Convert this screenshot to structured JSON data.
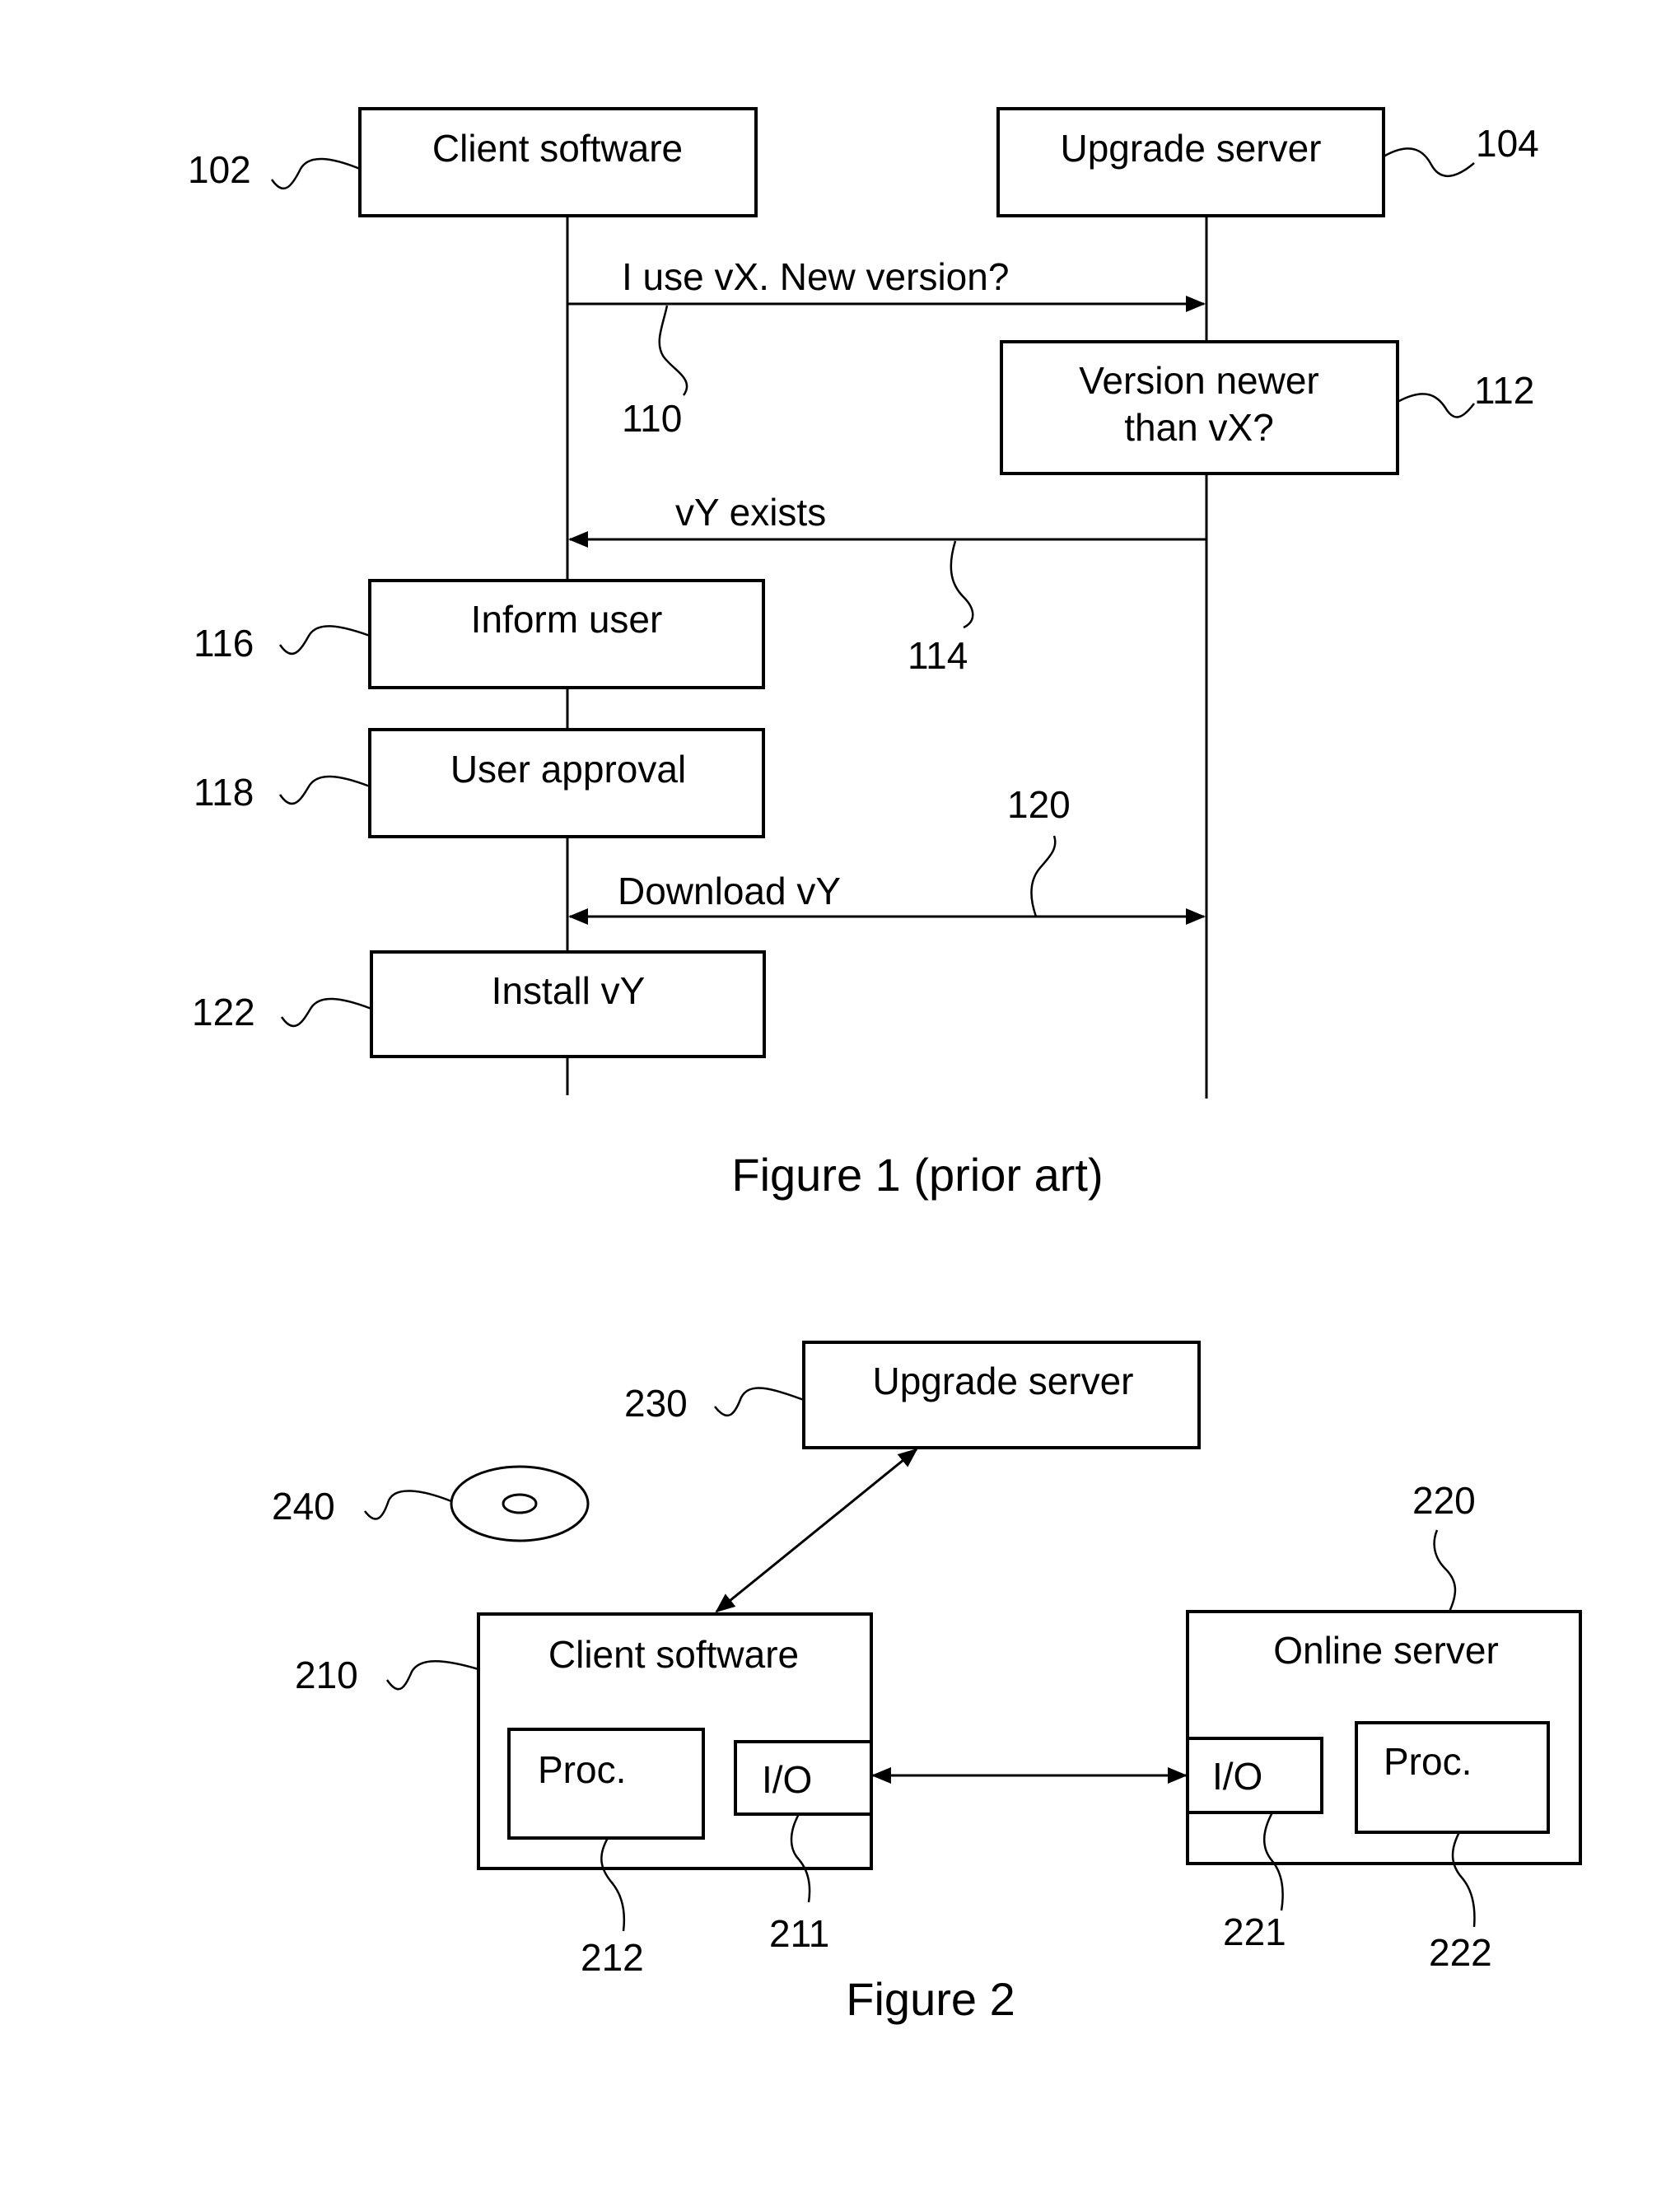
{
  "figure1": {
    "caption": "Figure 1 (prior art)",
    "lifelines": [
      {
        "ref": "102",
        "label": "Client software"
      },
      {
        "ref": "104",
        "label": "Upgrade server"
      }
    ],
    "steps": [
      {
        "ref": "112",
        "line1": "Version newer",
        "line2": "than vX?"
      },
      {
        "ref": "116",
        "label": "Inform user"
      },
      {
        "ref": "118",
        "label": "User approval"
      },
      {
        "ref": "122",
        "label": "Install vY"
      }
    ],
    "messages": [
      {
        "ref": "110",
        "label": "I use vX. New version?",
        "direction": "client-to-server"
      },
      {
        "ref": "114",
        "label": "vY exists",
        "direction": "server-to-client"
      },
      {
        "ref": "120",
        "label": "Download vY",
        "direction": "bidirectional"
      }
    ]
  },
  "figure2": {
    "caption": "Figure 2",
    "upgrade_server": {
      "ref": "230",
      "label": "Upgrade server"
    },
    "disc": {
      "ref": "240"
    },
    "client": {
      "ref": "210",
      "label": "Client software",
      "proc": {
        "ref": "212",
        "label": "Proc."
      },
      "io": {
        "ref": "211",
        "label": "I/O"
      }
    },
    "online_server": {
      "ref": "220",
      "label": "Online server",
      "io": {
        "ref": "221",
        "label": "I/O"
      },
      "proc": {
        "ref": "222",
        "label": "Proc."
      }
    }
  }
}
